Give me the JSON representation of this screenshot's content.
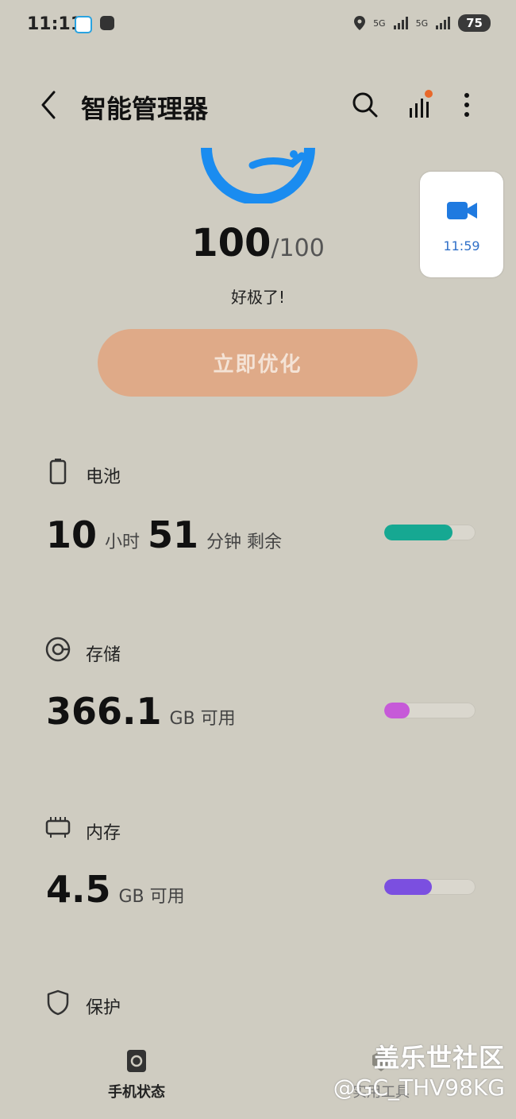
{
  "status_bar": {
    "time": "11:11",
    "net1": "5G",
    "net2": "5G",
    "battery": "75"
  },
  "header": {
    "title": "智能管理器"
  },
  "score": {
    "value": "100",
    "max": "/100",
    "status": "好极了!"
  },
  "optimize_button": "立即优化",
  "floating_widget": {
    "time": "11:59"
  },
  "sections": {
    "battery": {
      "title": "电池",
      "hours": "10",
      "hours_unit": "小时",
      "minutes": "51",
      "minutes_unit": "分钟 剩余",
      "level": 0.75
    },
    "storage": {
      "title": "存储",
      "value": "366.1",
      "unit": "GB 可用",
      "level": 0.28
    },
    "memory": {
      "title": "内存",
      "value": "4.5",
      "unit": "GB 可用",
      "level": 0.52
    },
    "protection": {
      "title": "保护"
    }
  },
  "bottom_nav": {
    "phone_status": "手机状态",
    "tools": "实用工具"
  },
  "watermark": {
    "line1": "盖乐世社区",
    "line2": "@GC_THV98KG"
  },
  "colors": {
    "battery_bar": "#16a892",
    "storage_bar": "#c65ad8",
    "memory_bar": "#7b4fe0",
    "gauge": "#1a8cf0",
    "button": "#dfaa88",
    "video_icon": "#1f7ae0"
  }
}
